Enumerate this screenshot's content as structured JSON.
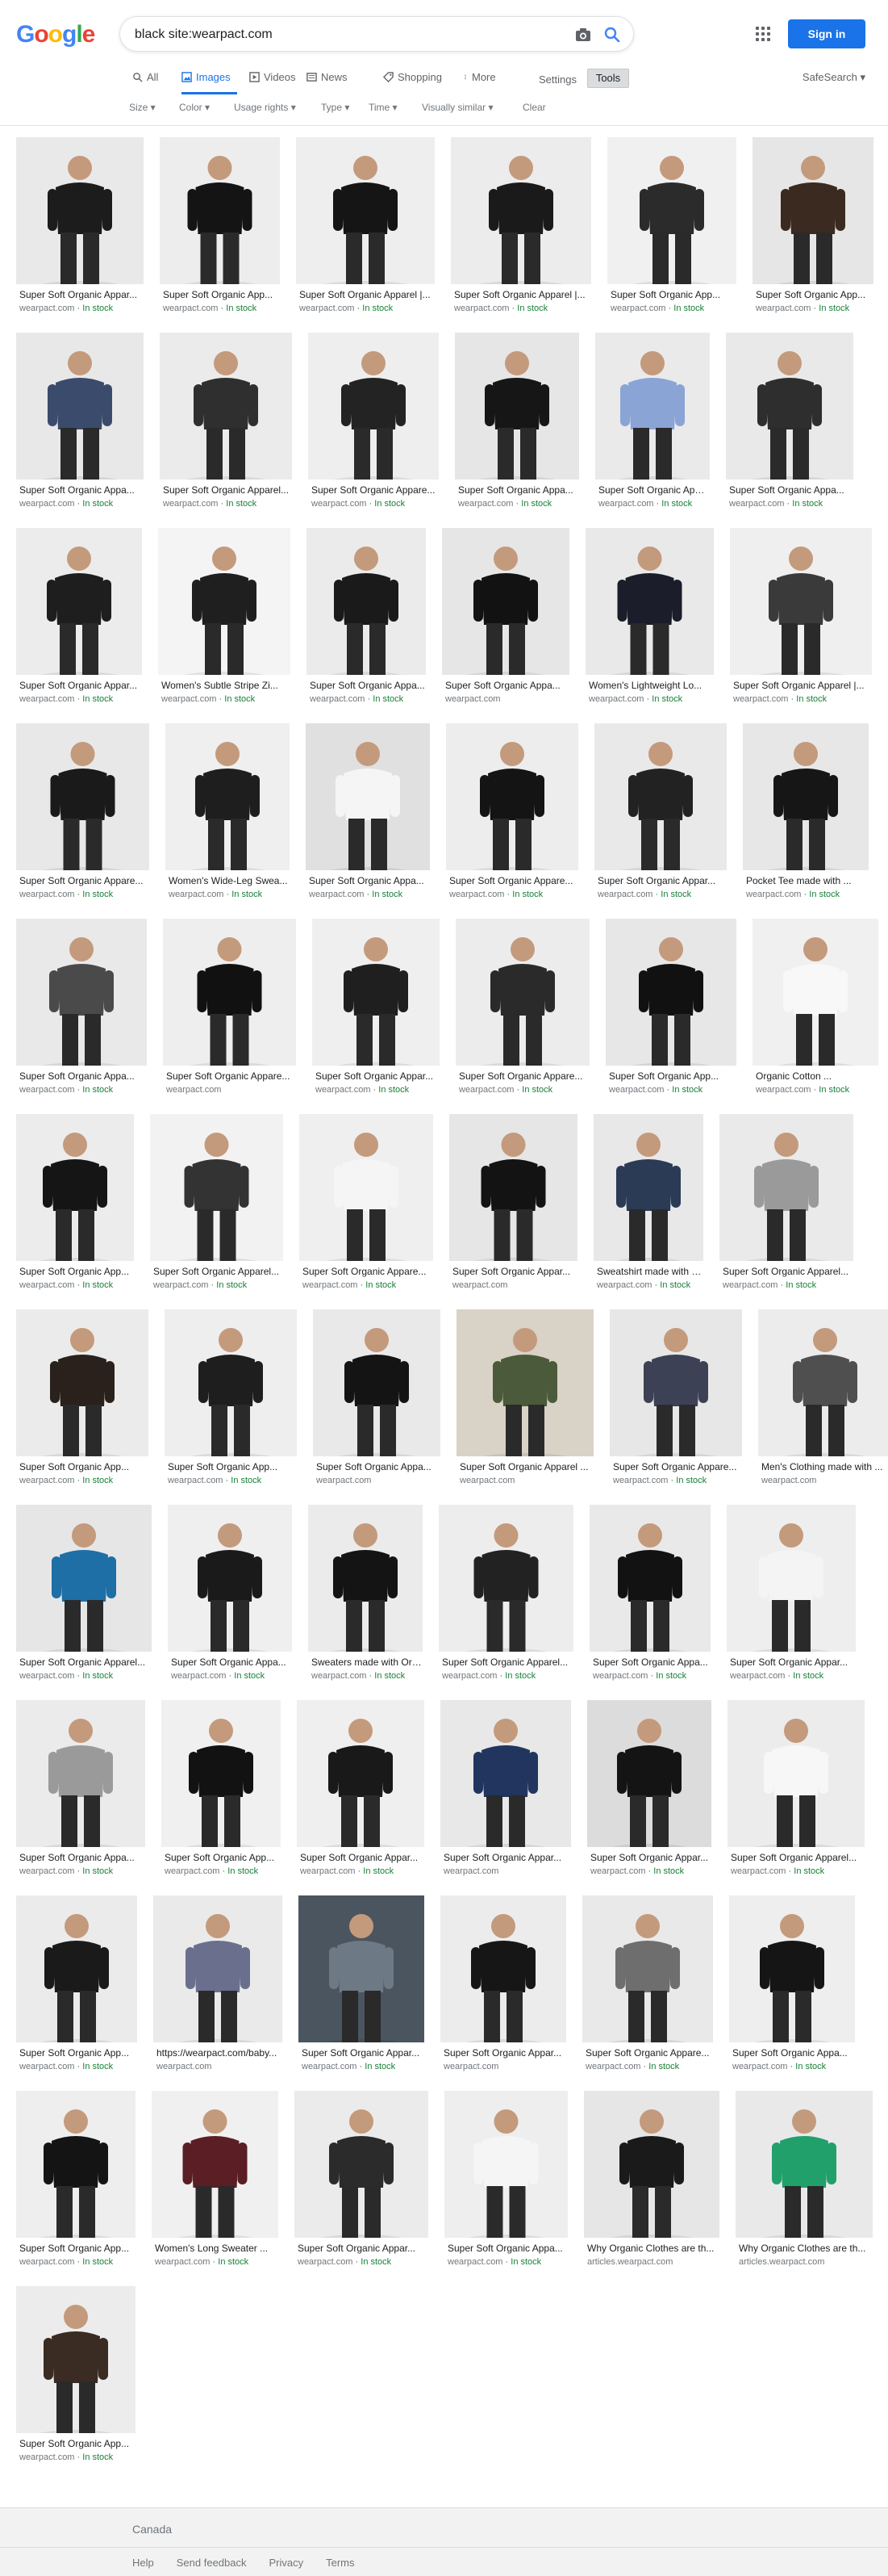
{
  "header": {
    "logo_letters": [
      {
        "char": "G",
        "color": "#4285f4"
      },
      {
        "char": "o",
        "color": "#ea4335"
      },
      {
        "char": "o",
        "color": "#fbbc05"
      },
      {
        "char": "g",
        "color": "#4285f4"
      },
      {
        "char": "l",
        "color": "#34a853"
      },
      {
        "char": "e",
        "color": "#ea4335"
      }
    ],
    "query": "black site:wearpact.com",
    "signin_label": "Sign in"
  },
  "tabs": [
    {
      "label": "All",
      "icon": "search-icon"
    },
    {
      "label": "Images",
      "icon": "image-icon",
      "active": true
    },
    {
      "label": "Videos",
      "icon": "video-icon"
    },
    {
      "label": "News",
      "icon": "news-icon"
    },
    {
      "label": "Shopping",
      "icon": "tag-icon"
    },
    {
      "label": "More",
      "icon": "more-vert-icon"
    }
  ],
  "settings_label": "Settings",
  "tools_label": "Tools",
  "safesearch_label": "SafeSearch ▾",
  "filters": [
    "Size ▾",
    "Color ▾",
    "Usage rights ▾",
    "Type ▾",
    "Time ▾",
    "Visually similar ▾",
    "Clear"
  ],
  "results": [
    [
      {
        "cap": "Super Soft Organic Appar...",
        "src": "wearpact.com",
        "stock": true,
        "bg": "#e9e9e9",
        "fg": "#1c1c1c"
      },
      {
        "cap": "Super Soft Organic App...",
        "src": "wearpact.com",
        "stock": true,
        "bg": "#ededed",
        "fg": "#141414"
      },
      {
        "cap": "Super Soft Organic Apparel |...",
        "src": "wearpact.com",
        "stock": true,
        "bg": "#eeeeee",
        "fg": "#151515"
      },
      {
        "cap": "Super Soft Organic Apparel |...",
        "src": "wearpact.com",
        "stock": true,
        "bg": "#ececec",
        "fg": "#1a1a1a"
      },
      {
        "cap": "Super Soft Organic App...",
        "src": "wearpact.com",
        "stock": true,
        "bg": "#f0f0f0",
        "fg": "#2b2b2b"
      },
      {
        "cap": "Super Soft Organic App...",
        "src": "wearpact.com",
        "stock": true,
        "bg": "#e6e6e6",
        "fg": "#3b2a20"
      }
    ],
    [
      {
        "cap": "Super Soft Organic Appa...",
        "src": "wearpact.com",
        "stock": true,
        "bg": "#e8e8e8",
        "fg": "#3b4b6b"
      },
      {
        "cap": "Super Soft Organic Apparel...",
        "src": "wearpact.com",
        "stock": true,
        "bg": "#ebebeb",
        "fg": "#2f2f2f"
      },
      {
        "cap": "Super Soft Organic Appare...",
        "src": "wearpact.com",
        "stock": true,
        "bg": "#eeeeee",
        "fg": "#232323"
      },
      {
        "cap": "Super Soft Organic Appa...",
        "src": "wearpact.com",
        "stock": true,
        "bg": "#e6e6e6",
        "fg": "#161616"
      },
      {
        "cap": "Super Soft Organic Appar...",
        "src": "wearpact.com",
        "stock": true,
        "bg": "#eaeaea",
        "fg": "#8aa4d6"
      },
      {
        "cap": "Super Soft Organic Appa...",
        "src": "wearpact.com",
        "stock": true,
        "bg": "#e9e9e9",
        "fg": "#2e2e2e"
      }
    ],
    [
      {
        "cap": "Super Soft Organic Appar...",
        "src": "wearpact.com",
        "stock": true,
        "bg": "#ececec",
        "fg": "#1e1e1e"
      },
      {
        "cap": "Women's Subtle Stripe Zi...",
        "src": "wearpact.com",
        "stock": true,
        "bg": "#f4f4f4",
        "fg": "#1f1f1f"
      },
      {
        "cap": "Super Soft Organic Appa...",
        "src": "wearpact.com",
        "stock": true,
        "bg": "#ebebeb",
        "fg": "#1a1a1a"
      },
      {
        "cap": "Super Soft Organic Appa...",
        "src": "wearpact.com",
        "stock": false,
        "bg": "#e6e6e6",
        "fg": "#121212"
      },
      {
        "cap": "Women's Lightweight Lo...",
        "src": "wearpact.com",
        "stock": true,
        "bg": "#e9e9e9",
        "fg": "#1b1d2b"
      },
      {
        "cap": "Super Soft Organic Apparel |...",
        "src": "wearpact.com",
        "stock": true,
        "bg": "#efefef",
        "fg": "#3a3a3a"
      }
    ],
    [
      {
        "cap": "Super Soft Organic Appare...",
        "src": "wearpact.com",
        "stock": true,
        "bg": "#e8e8e8",
        "fg": "#1a1a1a"
      },
      {
        "cap": "Women's Wide-Leg Swea...",
        "src": "wearpact.com",
        "stock": true,
        "bg": "#efefef",
        "fg": "#1e1e1e"
      },
      {
        "cap": "Super Soft Organic Appa...",
        "src": "wearpact.com",
        "stock": true,
        "bg": "#e0e0e0",
        "fg": "#f5f5f5"
      },
      {
        "cap": "Super Soft Organic Appare...",
        "src": "wearpact.com",
        "stock": true,
        "bg": "#ededed",
        "fg": "#141414"
      },
      {
        "cap": "Super Soft Organic Appar...",
        "src": "wearpact.com",
        "stock": true,
        "bg": "#e9e9e9",
        "fg": "#222222"
      },
      {
        "cap": "Pocket Tee made with ...",
        "src": "wearpact.com",
        "stock": true,
        "bg": "#e7e7e7",
        "fg": "#161616"
      }
    ],
    [
      {
        "cap": "Super Soft Organic Appa...",
        "src": "wearpact.com",
        "stock": true,
        "bg": "#e9e9e9",
        "fg": "#4a4a4a"
      },
      {
        "cap": "Super Soft Organic Appare...",
        "src": "wearpact.com",
        "stock": false,
        "bg": "#eeeeee",
        "fg": "#111111"
      },
      {
        "cap": "Super Soft Organic Appar...",
        "src": "wearpact.com",
        "stock": true,
        "bg": "#efefef",
        "fg": "#1f1f1f"
      },
      {
        "cap": "Super Soft Organic Appare...",
        "src": "wearpact.com",
        "stock": true,
        "bg": "#ececec",
        "fg": "#2a2a2a"
      },
      {
        "cap": "Super Soft Organic App...",
        "src": "wearpact.com",
        "stock": true,
        "bg": "#e7e7e7",
        "fg": "#111111"
      },
      {
        "cap": "Organic Cotton ...",
        "src": "wearpact.com",
        "stock": true,
        "bg": "#f0f0f0",
        "fg": "#f8f8f8"
      }
    ],
    [
      {
        "cap": "Super Soft Organic App...",
        "src": "wearpact.com",
        "stock": true,
        "bg": "#ececec",
        "fg": "#151515"
      },
      {
        "cap": "Super Soft Organic Apparel...",
        "src": "wearpact.com",
        "stock": true,
        "bg": "#f2f2f2",
        "fg": "#333333"
      },
      {
        "cap": "Super Soft Organic Appare...",
        "src": "wearpact.com",
        "stock": true,
        "bg": "#efefef",
        "fg": "#f5f5f5"
      },
      {
        "cap": "Super Soft Organic Appar...",
        "src": "wearpact.com",
        "stock": false,
        "bg": "#e6e6e6",
        "fg": "#131313"
      },
      {
        "cap": "Sweatshirt made with O...",
        "src": "wearpact.com",
        "stock": true,
        "bg": "#e8e8e8",
        "fg": "#2b3a55"
      },
      {
        "cap": "Super Soft Organic Apparel...",
        "src": "wearpact.com",
        "stock": true,
        "bg": "#eaeaea",
        "fg": "#9a9a9a"
      }
    ],
    [
      {
        "cap": "Super Soft Organic App...",
        "src": "wearpact.com",
        "stock": true,
        "bg": "#ebebeb",
        "fg": "#2a211c"
      },
      {
        "cap": "Super Soft Organic App...",
        "src": "wearpact.com",
        "stock": true,
        "bg": "#eeeeee",
        "fg": "#1e1e1e"
      },
      {
        "cap": "Super Soft Organic Appa...",
        "src": "wearpact.com",
        "stock": false,
        "bg": "#e9e9e9",
        "fg": "#141414"
      },
      {
        "cap": "Super Soft Organic Apparel ...",
        "src": "wearpact.com",
        "stock": false,
        "bg": "#d9d2c6",
        "fg": "#4b5a3a"
      },
      {
        "cap": "Super Soft Organic Appare...",
        "src": "wearpact.com",
        "stock": true,
        "bg": "#e7e7e7",
        "fg": "#3d4155"
      },
      {
        "cap": "Men's Clothing made with ...",
        "src": "wearpact.com",
        "stock": false,
        "bg": "#ececec",
        "fg": "#4f4f4f"
      }
    ],
    [
      {
        "cap": "Super Soft Organic Apparel...",
        "src": "wearpact.com",
        "stock": true,
        "bg": "#e6e6e6",
        "fg": "#1d6fa5"
      },
      {
        "cap": "Super Soft Organic Appa...",
        "src": "wearpact.com",
        "stock": true,
        "bg": "#efefef",
        "fg": "#1a1a1a"
      },
      {
        "cap": "Sweaters made with Org...",
        "src": "wearpact.com",
        "stock": true,
        "bg": "#ebebeb",
        "fg": "#141414"
      },
      {
        "cap": "Super Soft Organic Apparel...",
        "src": "wearpact.com",
        "stock": true,
        "bg": "#ededed",
        "fg": "#222222"
      },
      {
        "cap": "Super Soft Organic Appa...",
        "src": "wearpact.com",
        "stock": true,
        "bg": "#e9e9e9",
        "fg": "#121212"
      },
      {
        "cap": "Super Soft Organic Appar...",
        "src": "wearpact.com",
        "stock": true,
        "bg": "#eeeeee",
        "fg": "#f4f4f4"
      }
    ],
    [
      {
        "cap": "Super Soft Organic Appa...",
        "src": "wearpact.com",
        "stock": true,
        "bg": "#ebebeb",
        "fg": "#9a9a9a"
      },
      {
        "cap": "Super Soft Organic App...",
        "src": "wearpact.com",
        "stock": true,
        "bg": "#f0f0f0",
        "fg": "#121212"
      },
      {
        "cap": "Super Soft Organic Appar...",
        "src": "wearpact.com",
        "stock": true,
        "bg": "#efefef",
        "fg": "#191919"
      },
      {
        "cap": "Super Soft Organic Appar...",
        "src": "wearpact.com",
        "stock": false,
        "bg": "#e8e8e8",
        "fg": "#21355e"
      },
      {
        "cap": "Super Soft Organic Appar...",
        "src": "wearpact.com",
        "stock": true,
        "bg": "#dcdcdc",
        "fg": "#141414"
      },
      {
        "cap": "Super Soft Organic Apparel...",
        "src": "wearpact.com",
        "stock": true,
        "bg": "#ececec",
        "fg": "#f7f7f7"
      }
    ],
    [
      {
        "cap": "Super Soft Organic App...",
        "src": "wearpact.com",
        "stock": true,
        "bg": "#ebebeb",
        "fg": "#1a1a1a"
      },
      {
        "cap": "https://wearpact.com/baby...",
        "src": "wearpact.com",
        "stock": false,
        "bg": "#eaeaea",
        "fg": "#6b6f8e"
      },
      {
        "cap": "Super Soft Organic Appar...",
        "src": "wearpact.com",
        "stock": true,
        "bg": "#4a5560",
        "fg": "#6d7985"
      },
      {
        "cap": "Super Soft Organic Appar...",
        "src": "wearpact.com",
        "stock": false,
        "bg": "#ececec",
        "fg": "#161616"
      },
      {
        "cap": "Super Soft Organic Appare...",
        "src": "wearpact.com",
        "stock": true,
        "bg": "#e9e9e9",
        "fg": "#6e6e6e"
      },
      {
        "cap": "Super Soft Organic Appa...",
        "src": "wearpact.com",
        "stock": true,
        "bg": "#eeeeee",
        "fg": "#151515"
      }
    ],
    [
      {
        "cap": "Super Soft Organic App...",
        "src": "wearpact.com",
        "stock": true,
        "bg": "#eeeeee",
        "fg": "#141414"
      },
      {
        "cap": "Women's Long Sweater ...",
        "src": "wearpact.com",
        "stock": true,
        "bg": "#f0f0f0",
        "fg": "#5a1e24"
      },
      {
        "cap": "Super Soft Organic Appar...",
        "src": "wearpact.com",
        "stock": true,
        "bg": "#ebebeb",
        "fg": "#2b2b2b"
      },
      {
        "cap": "Super Soft Organic Appa...",
        "src": "wearpact.com",
        "stock": true,
        "bg": "#eeeeee",
        "fg": "#f5f5f5"
      },
      {
        "cap": "Why Organic Clothes are th...",
        "src": "articles.wearpact.com",
        "stock": false,
        "bg": "#e6e6e6",
        "fg": "#1a1a1a"
      },
      {
        "cap": "Why Organic Clothes are th...",
        "src": "articles.wearpact.com",
        "stock": false,
        "bg": "#e9e9e9",
        "fg": "#22a06b"
      }
    ],
    [
      {
        "cap": "Super Soft Organic App...",
        "src": "wearpact.com",
        "stock": true,
        "bg": "#ececec",
        "fg": "#3a2b23"
      }
    ]
  ],
  "in_stock_label": " · In stock",
  "footer": {
    "country": "Canada",
    "links": [
      "Help",
      "Send feedback",
      "Privacy",
      "Terms"
    ]
  }
}
